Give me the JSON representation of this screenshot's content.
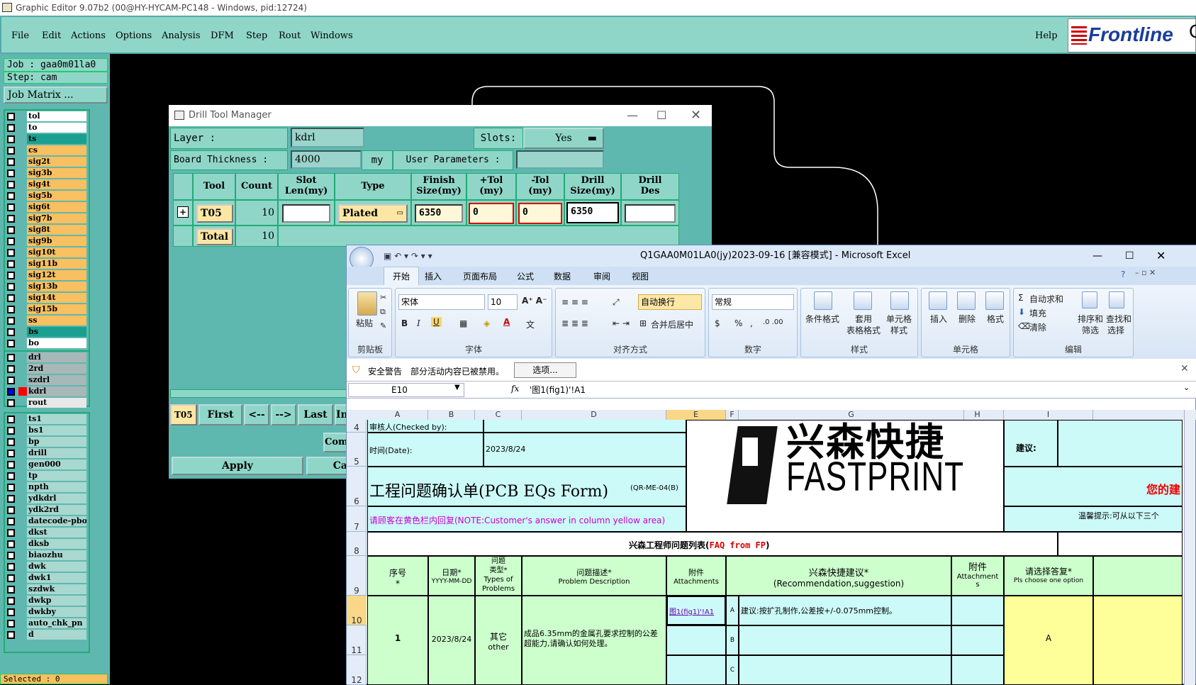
{
  "window_title": "Graphic Editor 9.07b2 (00@HY-HYCAM-PC148 - Windows, pid:12724)",
  "menu": [
    "File",
    "Edit",
    "Actions",
    "Options",
    "Analysis",
    "DFM",
    "Step",
    "Rout",
    "Windows"
  ],
  "help": "Help",
  "logo": "Frontline",
  "logo_edge": "C",
  "job": {
    "job_label": "Job : gaa0m01la0",
    "step_label": "Step: cam",
    "matrix_button": "Job Matrix ..."
  },
  "layers_a": [
    {
      "name": "tol",
      "color": "#ffffff"
    },
    {
      "name": "to",
      "color": "#ffffff"
    },
    {
      "name": "ts",
      "color": "#1aa090"
    },
    {
      "name": "cs",
      "color": "#f8c060"
    },
    {
      "name": "sig2t",
      "color": "#f8c060"
    },
    {
      "name": "sig3b",
      "color": "#f8c060"
    },
    {
      "name": "sig4t",
      "color": "#f8c060"
    },
    {
      "name": "sig5b",
      "color": "#f8c060"
    },
    {
      "name": "sig6t",
      "color": "#f8c060"
    },
    {
      "name": "sig7b",
      "color": "#f8c060"
    },
    {
      "name": "sig8t",
      "color": "#f8c060"
    },
    {
      "name": "sig9b",
      "color": "#f8c060"
    },
    {
      "name": "sig10t",
      "color": "#f8c060"
    },
    {
      "name": "sig11b",
      "color": "#f8c060"
    },
    {
      "name": "sig12t",
      "color": "#f8c060"
    },
    {
      "name": "sig13b",
      "color": "#f8c060"
    },
    {
      "name": "sig14t",
      "color": "#f8c060"
    },
    {
      "name": "sig15b",
      "color": "#f8c060"
    },
    {
      "name": "ss",
      "color": "#f8c060"
    },
    {
      "name": "bs",
      "color": "#1aa090"
    },
    {
      "name": "bo",
      "color": "#ffffff"
    }
  ],
  "layers_b": [
    {
      "name": "drl",
      "color": "#a8b8b8"
    },
    {
      "name": "2rd",
      "color": "#a8b8b8"
    },
    {
      "name": "szdrl",
      "color": "#a8b8b8"
    },
    {
      "name": "kdrl",
      "color": "#a8b8b8"
    },
    {
      "name": "rout",
      "color": "#e8e8e8"
    }
  ],
  "layers_c": [
    "ts1",
    "bs1",
    "bp",
    "drill",
    "gen000",
    "tp",
    "npth",
    "ydkdrl",
    "ydk2rd",
    "datecode-pbo",
    "dkst",
    "dksb",
    "biaozhu",
    "dwk",
    "dwk1",
    "szdwk",
    "dwkp",
    "dwkby",
    "auto_chk_pn",
    "d"
  ],
  "selected_label": "Selected : 0",
  "dtm": {
    "title": "Drill Tool Manager",
    "layer_label": "Layer :",
    "layer_value": "kdrl",
    "slots_label": "Slots:",
    "slots_value": "Yes",
    "thickness_label": "Board Thickness :",
    "thickness_value": "4000",
    "thickness_unit": "my",
    "user_params_label": "User Parameters :",
    "headers": [
      [
        "Tool"
      ],
      [
        "Count"
      ],
      [
        "Slot",
        "Len(my)"
      ],
      [
        "Type"
      ],
      [
        "Finish",
        "Size(my)"
      ],
      [
        "+Tol",
        "(my)"
      ],
      [
        "-Tol",
        "(my)"
      ],
      [
        "Drill",
        "Size(my)"
      ],
      [
        "Drill",
        "Des"
      ]
    ],
    "row": {
      "tool": "T05",
      "count": "10",
      "type": "Plated",
      "finish": "6350",
      "ptol": "0",
      "ntol": "0",
      "drill": "6350"
    },
    "total_label": "Total",
    "total_count": "10",
    "nav": {
      "current": "T05",
      "first": "First",
      "prev": "<--",
      "next": "-->",
      "last": "Last",
      "ind": "Ind"
    },
    "com": "Com",
    "apply": "Apply",
    "ca": "Ca"
  },
  "excel": {
    "title": "Q1GAA0M01LA0(jy)2023-09-16 [兼容模式] - Microsoft Excel",
    "tabs": [
      "开始",
      "插入",
      "页面布局",
      "公式",
      "数据",
      "审阅",
      "视图"
    ],
    "font_name": "宋体",
    "font_size": "10",
    "number_format": "常规",
    "paste": "粘贴",
    "clipboard": "剪贴板",
    "font_group": "字体",
    "align_group": "对齐方式",
    "number_group": "数字",
    "styles_group": "样式",
    "cells_group": "单元格",
    "edit_group": "编辑",
    "wrap": "自动换行",
    "merge": "合并后居中",
    "cond_format": "条件格式",
    "table_format": [
      "套用",
      "表格格式"
    ],
    "cell_style": [
      "单元格",
      "样式"
    ],
    "insert": "插入",
    "delete": "删除",
    "format": "格式",
    "autosum": "自动求和",
    "fill": "填充",
    "clear": "清除",
    "sort": [
      "排序和",
      "筛选"
    ],
    "find": [
      "查找和",
      "选择"
    ],
    "security_label": "安全警告",
    "security_text": "部分活动内容已被禁用。",
    "options_button": "选项...",
    "namebox": "E10",
    "formula": "'图1(fig1)'!A1",
    "columns": [
      "A",
      "B",
      "C",
      "D",
      "E",
      "F",
      "G",
      "H",
      "I"
    ],
    "rows": [
      "4",
      "5",
      "6",
      "7",
      "8",
      "9",
      "10",
      "11",
      "12"
    ],
    "reviewer": "审核人(Checked by):",
    "date_label": "时间(Date):",
    "date_value": "2023/8/24",
    "form_title": "工程问题确认单(PCB EQs Form)",
    "form_code": "(QR-ME-04(B)",
    "note": "请顾客在黄色栏内回复(NOTE:Customer's answer in column yellow area)",
    "fastprint": "FASTPRINT",
    "fastprint_cn": "兴森快捷",
    "suggest_label": "建议:",
    "your_suggest": "您的建",
    "tip": "温馨提示:可从以下三个",
    "faq_cn": "兴森工程师问题列表(",
    "faq_en": "FAQ from FP",
    "faq_close": ")",
    "hdr_seq": [
      "序号",
      "*"
    ],
    "hdr_date": [
      "日期*",
      "YYYY-MM-DD"
    ],
    "hdr_type": [
      "问题",
      "类型*",
      "Types of",
      "Problems"
    ],
    "hdr_desc": [
      "问题描述*",
      "Problem Description"
    ],
    "hdr_attach": [
      "附件",
      "Attachments"
    ],
    "hdr_sugg": [
      "兴森快捷建议*",
      "(Recommendation,suggestion)"
    ],
    "hdr_attach2": [
      "附件",
      "Attachment",
      "s"
    ],
    "hdr_answer": [
      "请选择答复*",
      "Pls choose one option"
    ],
    "r_seq": "1",
    "r_date": "2023/8/24",
    "r_type": [
      "其它",
      "other"
    ],
    "r_desc": "成品6.35mm的金属孔要求控制的公差超能力,请确认如何处理。",
    "r_attach": "图1(fig1)'!A1",
    "r_optA": "A",
    "r_optB": "B",
    "r_optC": "C",
    "r_sugg": "建议:按扩孔制作,公差按+/-0.075mm控制。",
    "r_answer": "A"
  }
}
